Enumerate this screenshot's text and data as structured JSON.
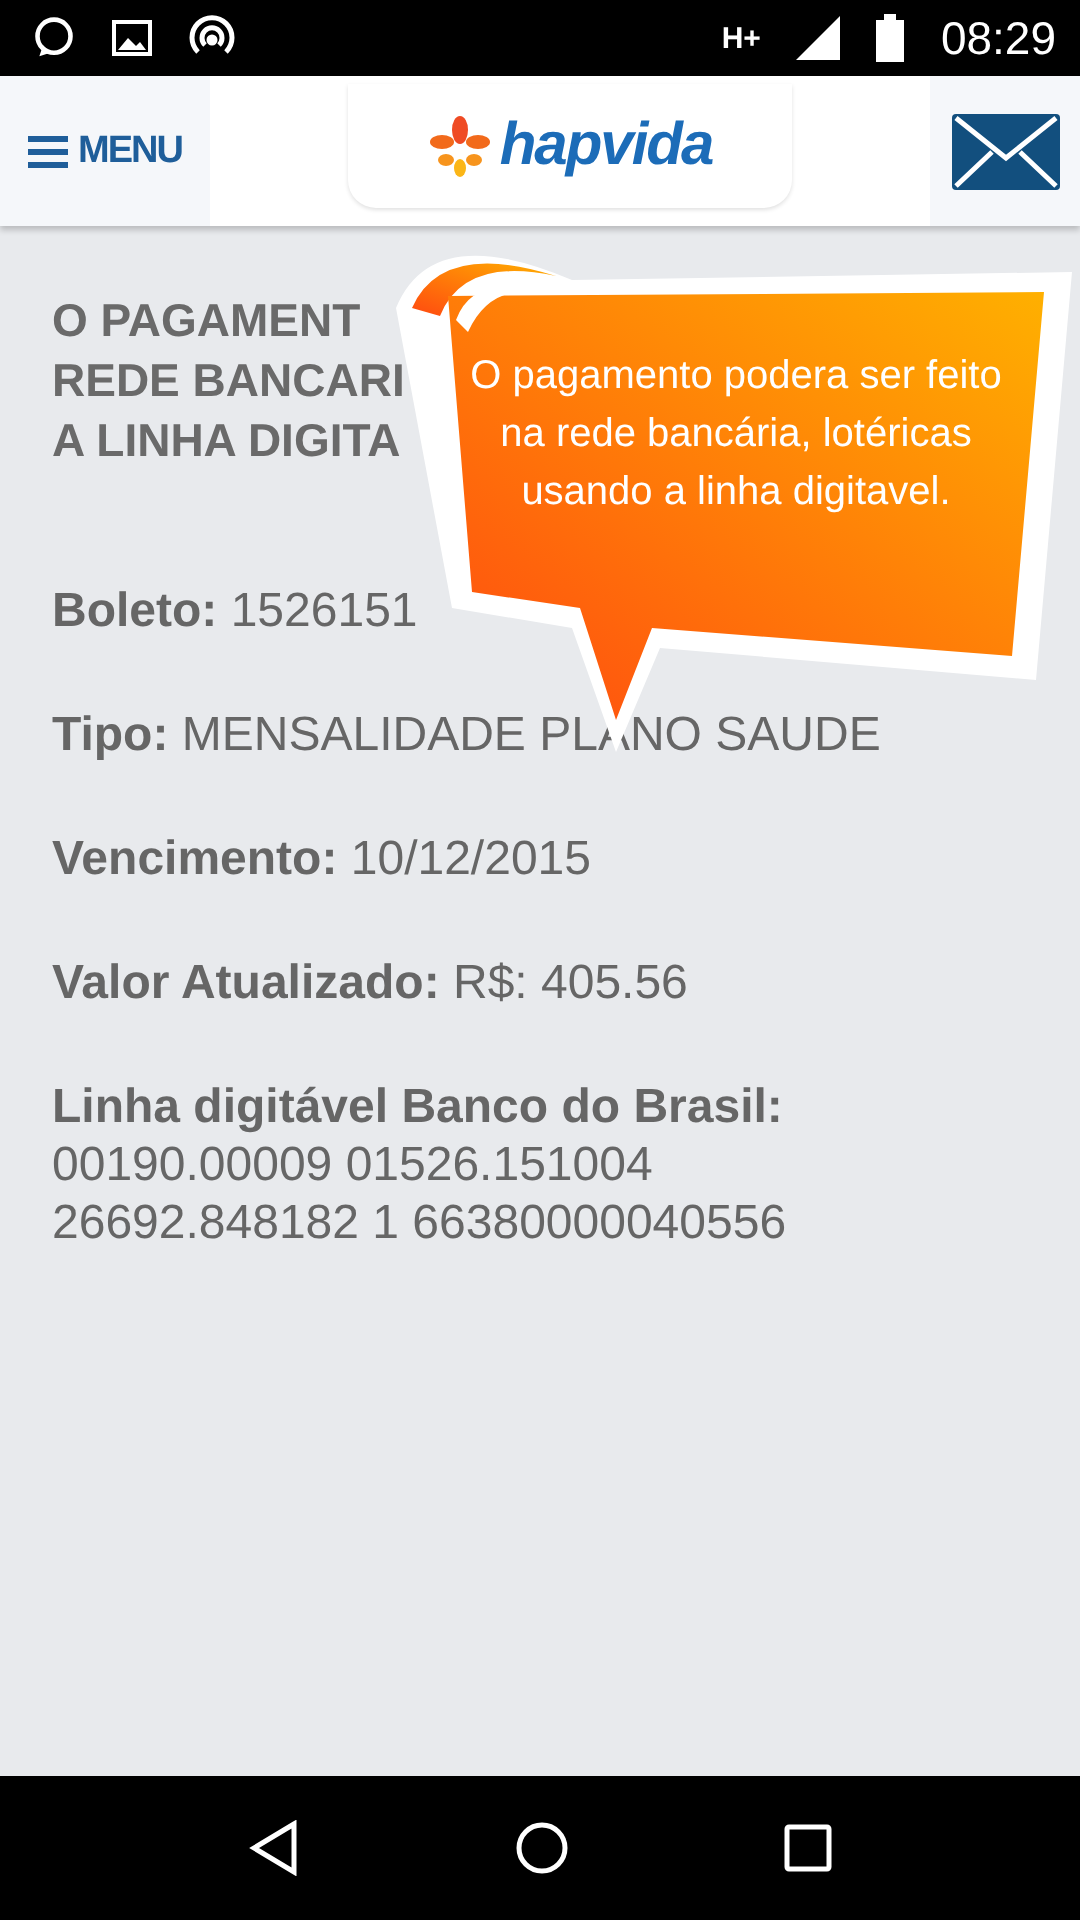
{
  "status_bar": {
    "network": "H+",
    "time": "08:29"
  },
  "header": {
    "menu_label": "MENU",
    "logo_text": "hapvida"
  },
  "notice": {
    "heading_lines": [
      "O PAGAMENT",
      "REDE BANCARI",
      "A LINHA DIGITA"
    ]
  },
  "fields": [
    {
      "label": "Boleto:",
      "value": "1526151"
    },
    {
      "label": "Tipo:",
      "value": "MENSALIDADE PLANO SAUDE"
    },
    {
      "label": "Vencimento:",
      "value": "10/12/2015"
    },
    {
      "label": "Valor Atualizado:",
      "value": "R$: 405.56"
    }
  ],
  "barcode": {
    "label": "Linha digitável Banco do Brasil:",
    "lines": [
      "00190.00009 01526.151004",
      "26692.848182 1 66380000040556"
    ]
  },
  "tooltip": {
    "text": "O pagamento podera ser feito na rede bancária, lotéricas usando a linha digitavel."
  }
}
